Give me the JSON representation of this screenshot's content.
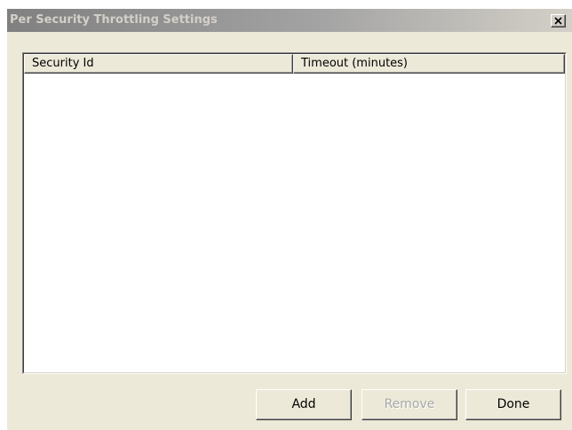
{
  "window": {
    "title": "Per Security Throttling Settings"
  },
  "list": {
    "columns": [
      {
        "label": "Security Id"
      },
      {
        "label": "Timeout (minutes)"
      }
    ],
    "rows": []
  },
  "buttons": {
    "add_label": "Add",
    "remove_label": "Remove",
    "remove_enabled": false,
    "done_label": "Done"
  },
  "icons": {
    "close": "close-icon"
  }
}
